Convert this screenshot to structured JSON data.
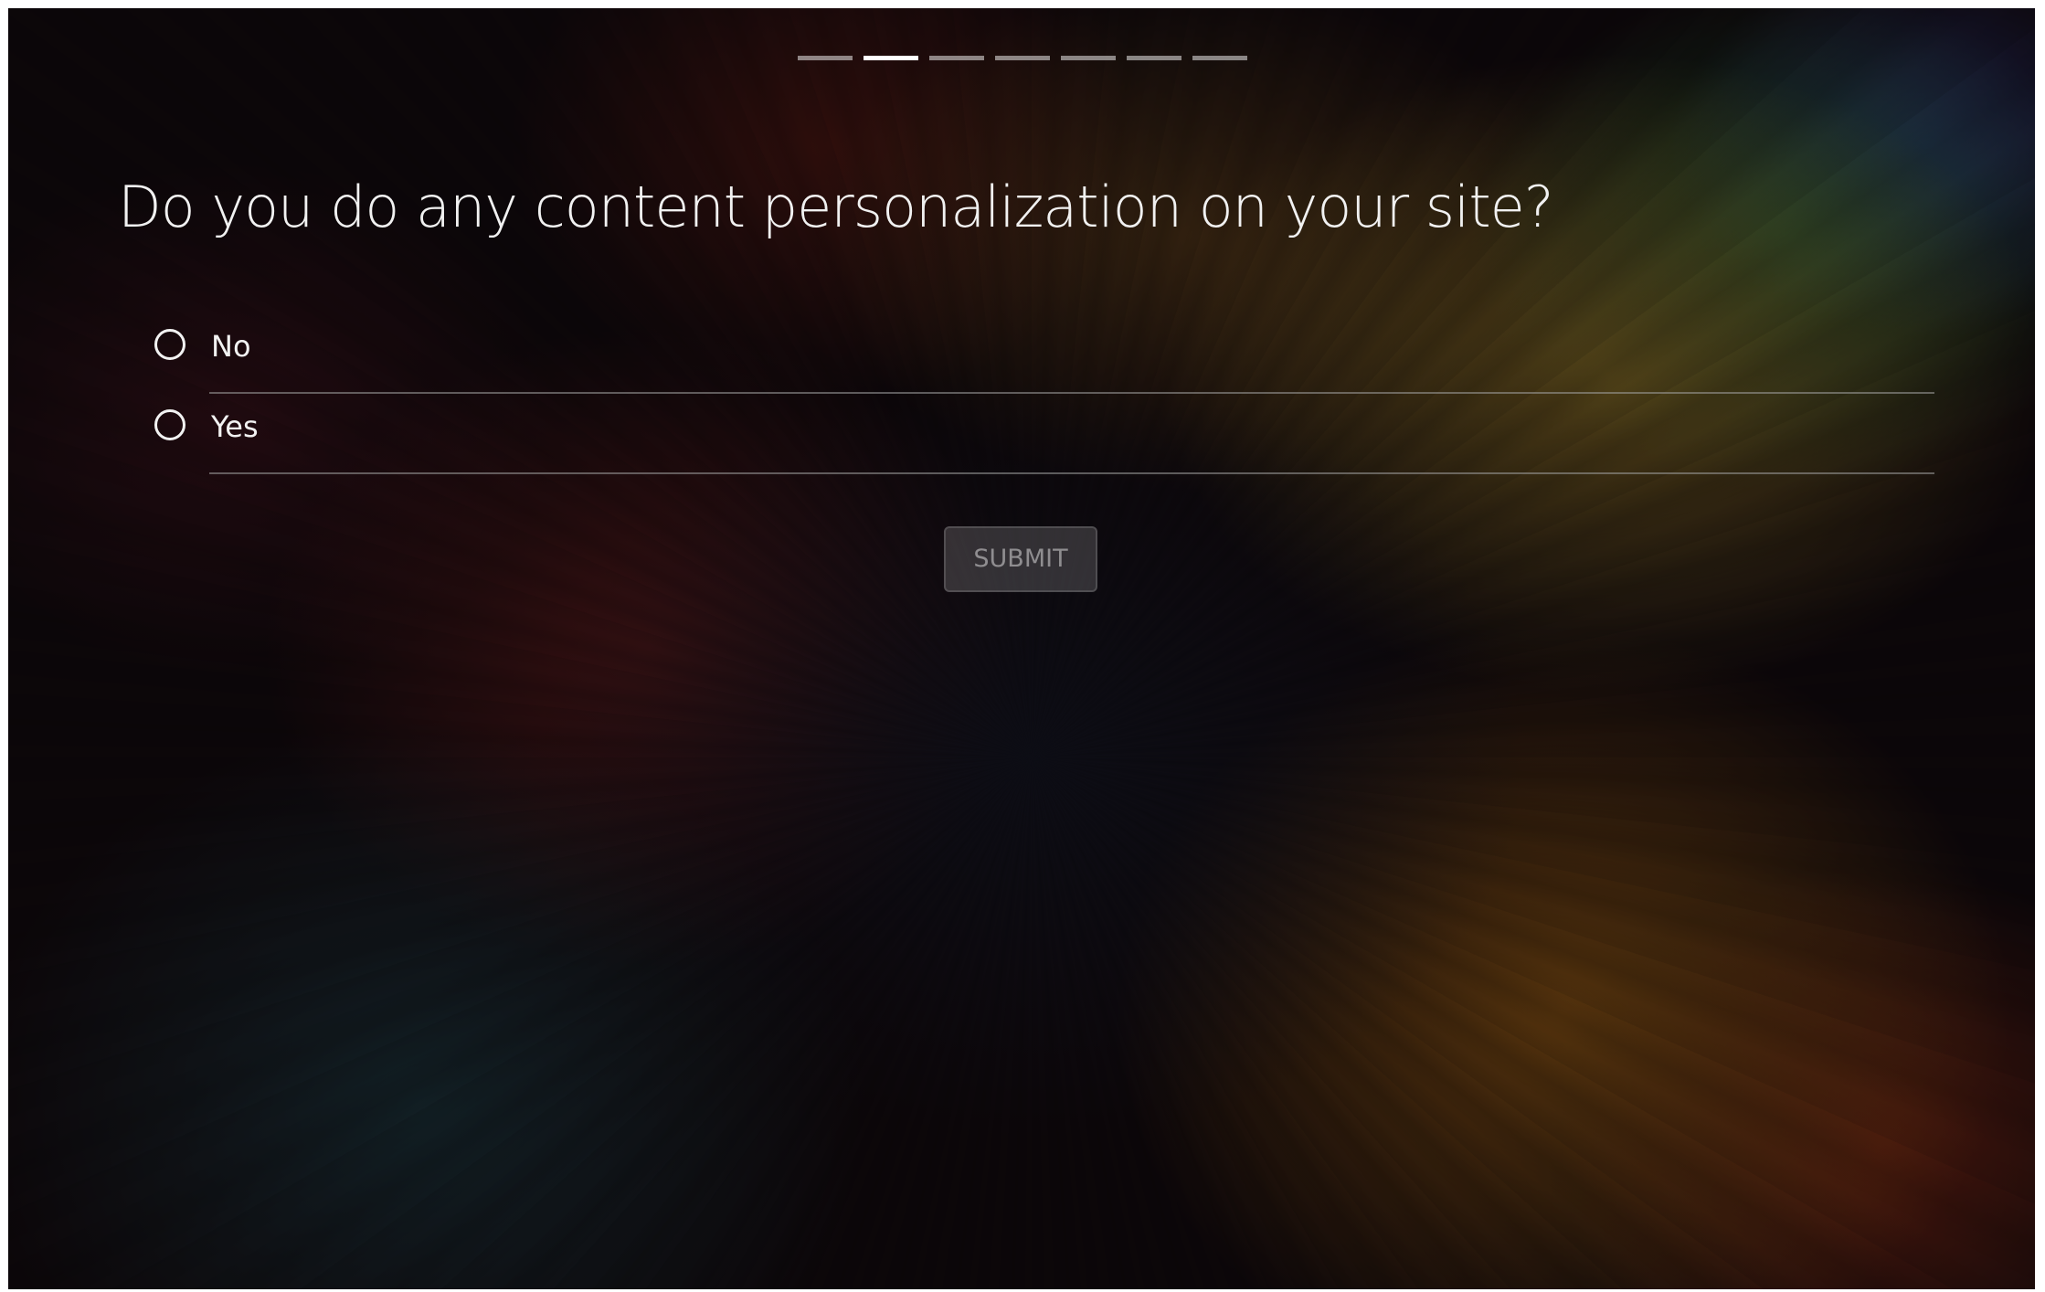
{
  "progress": {
    "total_steps": 7,
    "current_step": 2
  },
  "question": {
    "text": "Do you do any content personalization on your site?"
  },
  "options": [
    {
      "label": "No",
      "selected": false
    },
    {
      "label": "Yes",
      "selected": false
    }
  ],
  "submit": {
    "label": "SUBMIT",
    "enabled": false
  },
  "colors": {
    "text": "#f1f1f1",
    "progress_active": "#ffffff",
    "progress_inactive": "#9a9a9a",
    "divider": "#8a8a8a"
  }
}
